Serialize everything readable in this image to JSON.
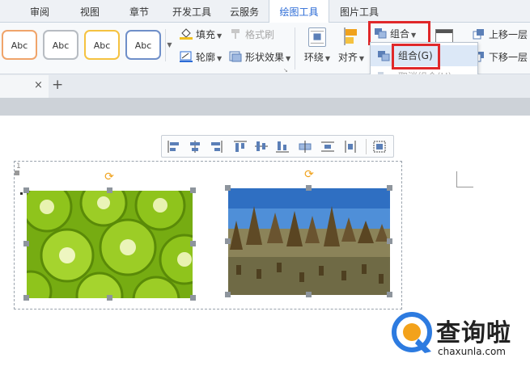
{
  "tabs": [
    {
      "label": "审阅",
      "active": false
    },
    {
      "label": "视图",
      "active": false
    },
    {
      "label": "章节",
      "active": false
    },
    {
      "label": "开发工具",
      "active": false
    },
    {
      "label": "云服务",
      "active": false
    },
    {
      "label": "绘图工具",
      "active": true
    },
    {
      "label": "图片工具",
      "active": false
    }
  ],
  "ribbon": {
    "styles": [
      "Abc",
      "Abc",
      "Abc",
      "Abc"
    ],
    "style_border_colors": [
      "#f0a46a",
      "#b7bcc2",
      "#f5c240",
      "#6f8fc9"
    ],
    "fill_label": "填充",
    "format_painter_label": "格式刷",
    "outline_label": "轮廓",
    "shape_effects_label": "形状效果",
    "wrap_label": "环绕",
    "align_label": "对齐",
    "group_label": "组合",
    "bring_forward_label": "上移一层",
    "send_backward_label": "下移一层"
  },
  "group_menu": {
    "items": [
      {
        "label": "组合(G)",
        "enabled": true,
        "highlighted": true
      },
      {
        "label": "取消组合(U)",
        "enabled": false,
        "highlighted": false
      }
    ]
  },
  "doc_tab": {
    "close_glyph": "×",
    "new_tab_glyph": "+"
  },
  "floating_toolbar": {
    "buttons": [
      "align-left",
      "align-center",
      "align-right",
      "align-top",
      "align-middle",
      "align-bottom",
      "distribute-horizontal",
      "distribute-vertical",
      "distribute-columns",
      "select-group"
    ]
  },
  "images": [
    {
      "name": "kiwi-slices"
    },
    {
      "name": "rice-straw-field"
    }
  ],
  "watermark": {
    "brand": "查询啦",
    "url": "chaxunla.com"
  },
  "colors": {
    "accent": "#2b6bd6",
    "highlight_red": "#e0282a",
    "rotate_handle": "#f0a21c"
  }
}
